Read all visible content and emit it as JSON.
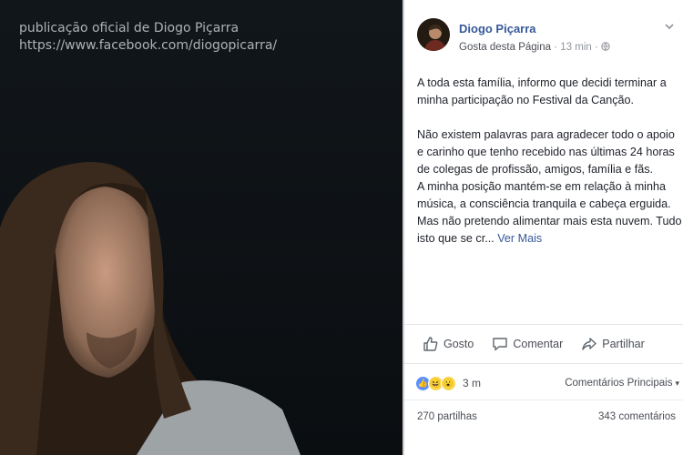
{
  "watermark": {
    "line1": "publicação oficial de Diogo Piçarra",
    "line2": "https://www.facebook.com/diogopicarra/"
  },
  "post": {
    "page_name": "Diogo Piçarra",
    "like_page": "Gosta desta Página",
    "separator": "·",
    "time": "13 min",
    "privacy_icon": "globe-icon",
    "more_icon": "chevron-down-icon",
    "paragraph1": "A toda esta família, informo que decidi terminar a minha participação no Festival da Canção.",
    "paragraph2a": "Não existem palavras para agradecer todo o apoio e carinho que tenho recebido nas últimas 24 horas de colegas de profissão, amigos, família e fãs.",
    "paragraph2b": "A minha posição mantém-se em relação à minha música, a consciência tranquila e cabeça erguida. Mas não pretendo alimentar mais esta nuvem. Tudo isto que se cr...",
    "see_more": "Ver Mais"
  },
  "actions": {
    "like": "Gosto",
    "comment": "Comentar",
    "share": "Partilhar"
  },
  "reactions": {
    "icons": [
      "like",
      "haha",
      "wow"
    ],
    "count": "3 m",
    "sort_label": "Comentários Principais",
    "sort_arrow": "▾"
  },
  "footer": {
    "shares": "270 partilhas",
    "comments": "343 comentários"
  },
  "colors": {
    "link": "#365899",
    "text": "#1d2129",
    "muted": "#90949c",
    "like": "#5890ff"
  }
}
